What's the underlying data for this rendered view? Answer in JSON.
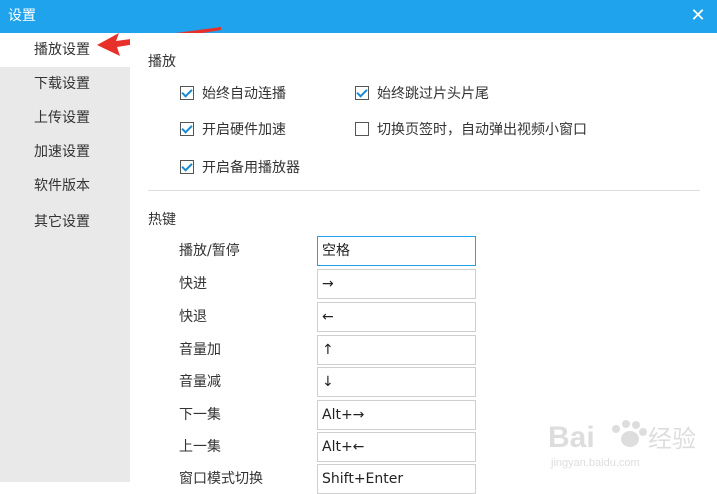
{
  "window": {
    "title": "设置",
    "close_icon": "close-icon"
  },
  "sidebar": {
    "items": [
      {
        "label": "播放设置",
        "active": true
      },
      {
        "label": "下载设置"
      },
      {
        "label": "上传设置"
      },
      {
        "label": "加速设置"
      },
      {
        "label": "软件版本"
      },
      {
        "label": "其它设置"
      }
    ]
  },
  "playback": {
    "section_title": "播放",
    "options": [
      {
        "label": "始终自动连播",
        "checked": true
      },
      {
        "label": "始终跳过片头片尾",
        "checked": true
      },
      {
        "label": "开启硬件加速",
        "checked": true
      },
      {
        "label": "切换页签时，自动弹出视频小窗口",
        "checked": false
      },
      {
        "label": "开启备用播放器",
        "checked": true
      }
    ]
  },
  "hotkeys": {
    "section_title": "热键",
    "rows": [
      {
        "label": "播放/暂停",
        "value": "空格"
      },
      {
        "label": "快进",
        "value": "→"
      },
      {
        "label": "快退",
        "value": "←"
      },
      {
        "label": "音量加",
        "value": "↑"
      },
      {
        "label": "音量减",
        "value": "↓"
      },
      {
        "label": "下一集",
        "value": "Alt+→"
      },
      {
        "label": "上一集",
        "value": "Alt+←"
      },
      {
        "label": "窗口模式切换",
        "value": "Shift+Enter"
      }
    ]
  },
  "watermark": {
    "brand": "Bai",
    "brand2": "经验",
    "url": "jingyan.baidu.com"
  },
  "colors": {
    "accent": "#1fa3ec",
    "annotation_arrow": "#e8302a"
  }
}
